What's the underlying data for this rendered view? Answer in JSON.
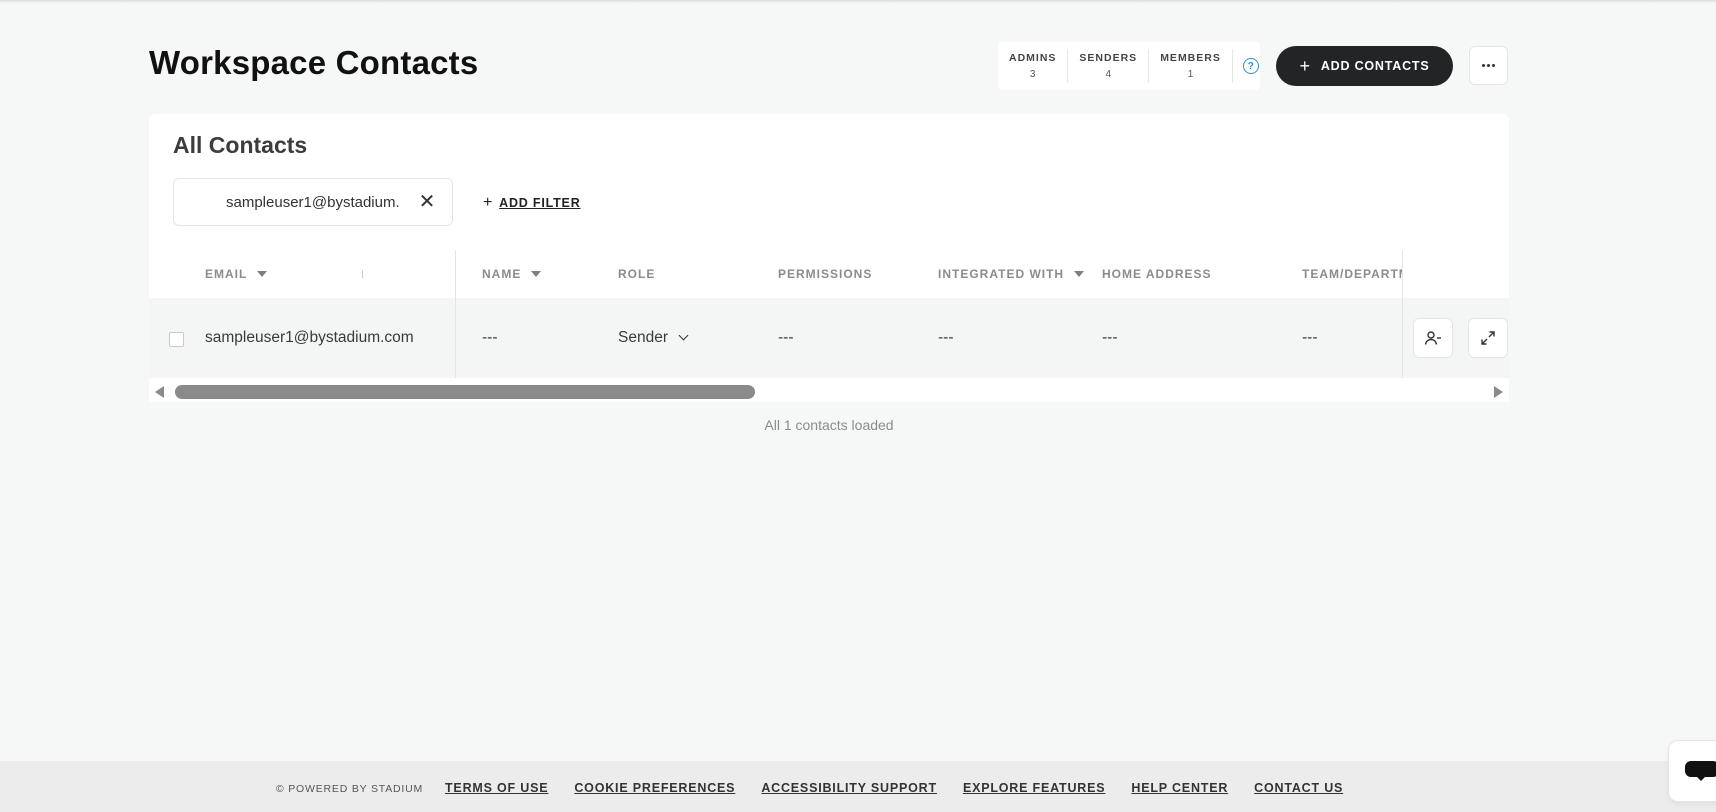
{
  "header": {
    "title": "Workspace Contacts",
    "stats": [
      {
        "label": "ADMINS",
        "value": "3"
      },
      {
        "label": "SENDERS",
        "value": "4"
      },
      {
        "label": "MEMBERS",
        "value": "1"
      }
    ],
    "help_icon_glyph": "?",
    "add_contacts_label": "ADD CONTACTS",
    "plus_glyph": "+"
  },
  "contacts": {
    "title": "All Contacts",
    "filter_value": "sampleuser1@bystadium.",
    "clear_filter_glyph": "✕",
    "add_filter_label": "ADD FILTER",
    "columns": {
      "email": "EMAIL",
      "name": "NAME",
      "role": "ROLE",
      "permissions": "PERMISSIONS",
      "integrated_with": "INTEGRATED WITH",
      "home_address": "HOME ADDRESS",
      "team": "TEAM/DEPARTM"
    },
    "rows": [
      {
        "email": "sampleuser1@bystadium.com",
        "name": "---",
        "role": "Sender",
        "permissions": "---",
        "integrated_with": "---",
        "home_address": "---",
        "team": "---"
      }
    ],
    "loaded_text": "All 1 contacts loaded"
  },
  "footer": {
    "powered": "© POWERED BY STADIUM",
    "links": [
      "TERMS OF USE",
      "COOKIE PREFERENCES",
      "ACCESSIBILITY SUPPORT",
      "EXPLORE FEATURES",
      "HELP CENTER",
      "CONTACT US"
    ]
  },
  "icons": {
    "help": "question-circle-icon",
    "more": "ellipsis-icon",
    "remove_user": "user-minus-icon",
    "expand": "expand-icon",
    "chat": "chat-bubble-icon"
  },
  "colors": {
    "primary_button": "#232425",
    "help_accent": "#2b8fd6",
    "page_background": "#f6f8f7"
  }
}
